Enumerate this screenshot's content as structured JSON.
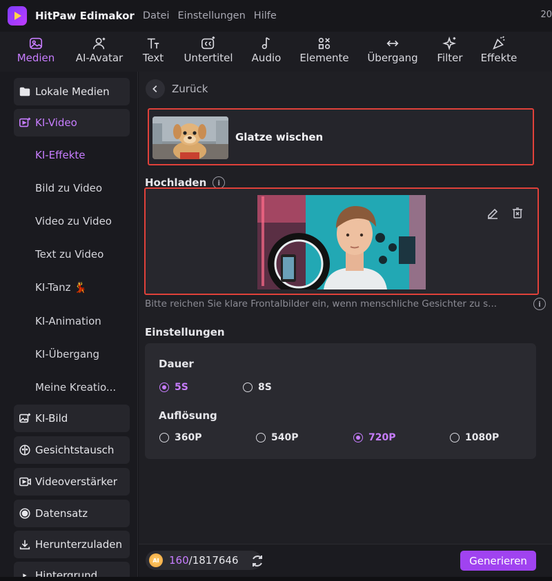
{
  "app": {
    "title": "HitPaw Edimakor",
    "menu": [
      "Datei",
      "Einstellungen",
      "Hilfe"
    ],
    "right_clip": "20"
  },
  "toolbar": [
    {
      "label": "Medien",
      "icon": "media-icon",
      "active": true
    },
    {
      "label": "AI-Avatar",
      "icon": "avatar-icon",
      "active": false
    },
    {
      "label": "Text",
      "icon": "text-icon",
      "active": false
    },
    {
      "label": "Untertitel",
      "icon": "subtitle-icon",
      "active": false
    },
    {
      "label": "Audio",
      "icon": "music-note-icon",
      "active": false
    },
    {
      "label": "Elemente",
      "icon": "elements-icon",
      "active": false
    },
    {
      "label": "Übergang",
      "icon": "transition-icon",
      "active": false
    },
    {
      "label": "Filter",
      "icon": "sparkle-icon",
      "active": false
    },
    {
      "label": "Effekte",
      "icon": "effects-icon",
      "active": false
    }
  ],
  "sidebar": {
    "items": [
      {
        "label": "Lokale Medien",
        "icon": "folder-icon"
      },
      {
        "label": "KI-Video",
        "icon": "ai-video-icon",
        "active": true
      },
      {
        "label": "KI-Bild",
        "icon": "ai-image-icon"
      },
      {
        "label": "Gesichtstausch",
        "icon": "face-swap-icon"
      },
      {
        "label": "Videoverstärker",
        "icon": "video-enhance-icon"
      },
      {
        "label": "Datensatz",
        "icon": "dataset-icon"
      },
      {
        "label": "Herunterzuladen",
        "icon": "download-icon"
      },
      {
        "label": "Hintergrund",
        "icon": "background-icon"
      }
    ],
    "sub_items": [
      {
        "label": "KI-Effekte",
        "active": true
      },
      {
        "label": "Bild zu Video"
      },
      {
        "label": "Video zu Video"
      },
      {
        "label": "Text zu Video"
      },
      {
        "label": "KI-Tanz 💃"
      },
      {
        "label": "KI-Animation"
      },
      {
        "label": "KI-Übergang"
      },
      {
        "label": "Meine Kreatio..."
      }
    ]
  },
  "main": {
    "back_label": "Zurück",
    "effect_name": "Glatze wischen",
    "upload_label": "Hochladen",
    "hint": "Bitte reichen Sie klare Frontalbilder ein, wenn menschliche Gesichter zu s...",
    "settings_label": "Einstellungen",
    "duration": {
      "title": "Dauer",
      "options": [
        "5S",
        "8S"
      ],
      "selected": "5S"
    },
    "resolution": {
      "title": "Auflösung",
      "options": [
        "360P",
        "540P",
        "720P",
        "1080P"
      ],
      "selected": "720P"
    }
  },
  "footer": {
    "credits_current": "160",
    "credits_total": "/1817646",
    "coin_label": "AI",
    "generate_label": "Generieren"
  },
  "colors": {
    "accent": "#c77dff",
    "button": "#a043f0",
    "highlight_border": "#e0413a"
  }
}
